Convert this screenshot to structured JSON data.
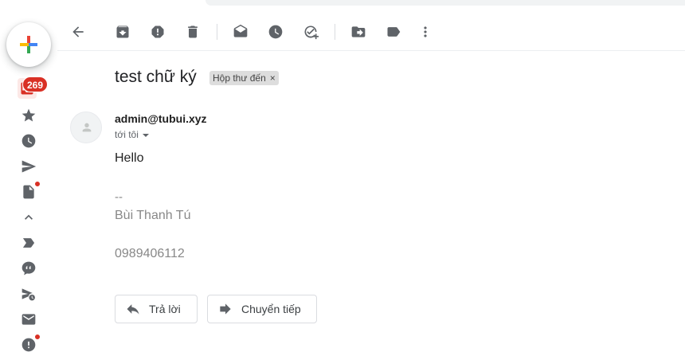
{
  "mail": {
    "subject": "test chữ ký",
    "label": "Hộp thư đến",
    "label_remove": "×",
    "sender": "admin@tubui.xyz",
    "recipient": "tới tôi",
    "body": {
      "greeting": "Hello",
      "signature_separator": "--",
      "signature_name": "Bùi Thanh Tú",
      "signature_phone": "0989406112"
    }
  },
  "sidebar": {
    "inbox_unread": "269",
    "icons": [
      "inbox-icon",
      "star-icon",
      "clock-icon",
      "send-icon",
      "draft-icon",
      "chevron-up-icon",
      "label-icon",
      "chat-icon",
      "scheduled-send-icon",
      "mail-icon",
      "spam-icon"
    ],
    "accent": "#d93025"
  },
  "toolbar": {
    "icons": [
      "back-arrow-icon",
      "archive-icon",
      "report-spam-icon",
      "delete-icon",
      "mark-unread-icon",
      "snooze-icon",
      "add-task-icon",
      "move-to-icon",
      "labels-icon",
      "more-vert-icon"
    ]
  },
  "actions": {
    "reply": "Trả lời",
    "forward": "Chuyển tiếp"
  }
}
